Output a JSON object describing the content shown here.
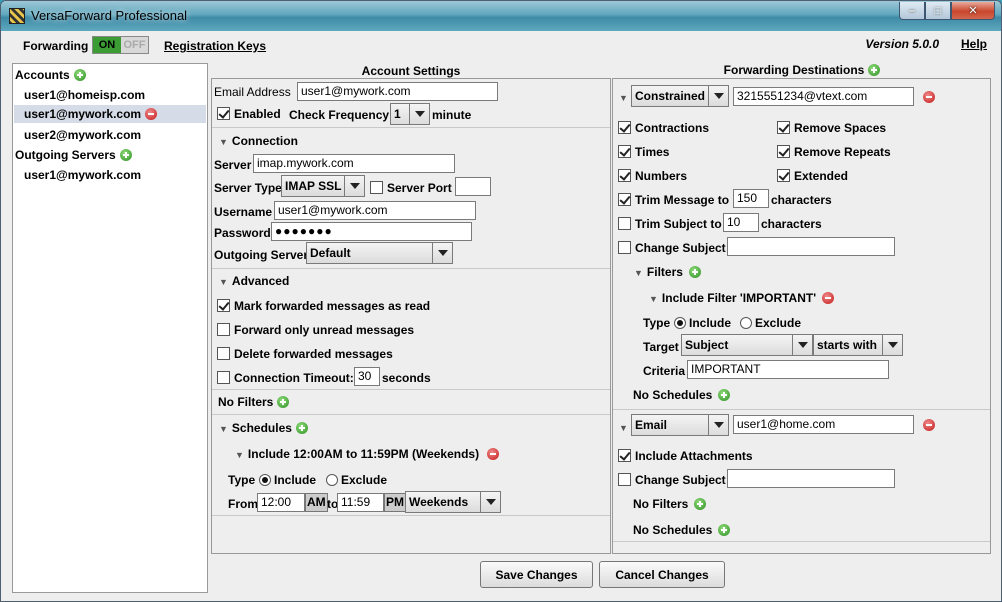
{
  "window": {
    "title": "VersaForward Professional",
    "controls": {
      "minimize": "–",
      "maximize": "□",
      "close": "✕"
    }
  },
  "toolbar": {
    "forwarding_label": "Forwarding",
    "toggle_on": "ON",
    "toggle_off": "OFF",
    "registration_link": "Registration Keys",
    "version": "Version 5.0.0",
    "help_link": "Help"
  },
  "sidebar": {
    "accounts_header": "Accounts",
    "accounts": [
      "user1@homeisp.com",
      "user1@mywork.com",
      "user2@mywork.com"
    ],
    "selected_account_index": 1,
    "outgoing_header": "Outgoing Servers",
    "outgoing": [
      "user1@mywork.com"
    ]
  },
  "account": {
    "header": "Account Settings",
    "email_label": "Email Address",
    "email_value": "user1@mywork.com",
    "enabled_label": "Enabled",
    "check_freq_label": "Check Frequency:",
    "check_freq_value": "1",
    "minute_label": "minute",
    "connection_label": "Connection",
    "server_label": "Server",
    "server_value": "imap.mywork.com",
    "server_type_label": "Server Type",
    "server_type_value": "IMAP SSL",
    "server_port_label": "Server Port",
    "server_port_value": "",
    "username_label": "Username",
    "username_value": "user1@mywork.com",
    "password_label": "Password",
    "password_value": "●●●●●●●",
    "outgoing_label": "Outgoing Server",
    "outgoing_value": "Default",
    "advanced_label": "Advanced",
    "mark_read_label": "Mark forwarded messages as read",
    "unread_only_label": "Forward only unread messages",
    "delete_label": "Delete forwarded messages",
    "timeout_label": "Connection Timeout:",
    "timeout_value": "30",
    "seconds_label": "seconds",
    "no_filters_label": "No Filters",
    "schedules_label": "Schedules",
    "schedule_title": "Include 12:00AM to 11:59PM (Weekends)",
    "type_label": "Type",
    "include_label": "Include",
    "exclude_label": "Exclude",
    "from_label": "From",
    "from_time": "12:00",
    "from_ampm": "AM",
    "to_label": "to",
    "to_time": "11:59",
    "to_ampm": "PM",
    "days_value": "Weekends"
  },
  "destinations": {
    "header": "Forwarding Destinations",
    "dest1": {
      "type_value": "Constrained",
      "address": "3215551234@vtext.com",
      "contractions_label": "Contractions",
      "remove_spaces_label": "Remove Spaces",
      "times_label": "Times",
      "remove_repeats_label": "Remove Repeats",
      "numbers_label": "Numbers",
      "extended_label": "Extended",
      "trim_message_label": "Trim Message to",
      "trim_message_value": "150",
      "characters_label": "characters",
      "trim_subject_label": "Trim Subject to",
      "trim_subject_value": "10",
      "change_subject_label": "Change Subject",
      "change_subject_value": "",
      "filters_label": "Filters",
      "filter_title": "Include Filter 'IMPORTANT'",
      "type_label": "Type",
      "include_label": "Include",
      "exclude_label": "Exclude",
      "target_label": "Target",
      "target_value": "Subject",
      "operator_value": "starts with",
      "criteria_label": "Criteria",
      "criteria_value": "IMPORTANT",
      "no_schedules_label": "No Schedules"
    },
    "dest2": {
      "type_value": "Email",
      "address": "user1@home.com",
      "include_attachments_label": "Include Attachments",
      "change_subject_label": "Change Subject",
      "change_subject_value": "",
      "no_filters_label": "No Filters",
      "no_schedules_label": "No Schedules"
    }
  },
  "footer": {
    "save_label": "Save Changes",
    "cancel_label": "Cancel Changes"
  },
  "colors": {
    "toggle_on": "#3a9c33",
    "add_icon": "#2e8f24",
    "remove_icon": "#c41818",
    "selection": "#d5dce7"
  }
}
